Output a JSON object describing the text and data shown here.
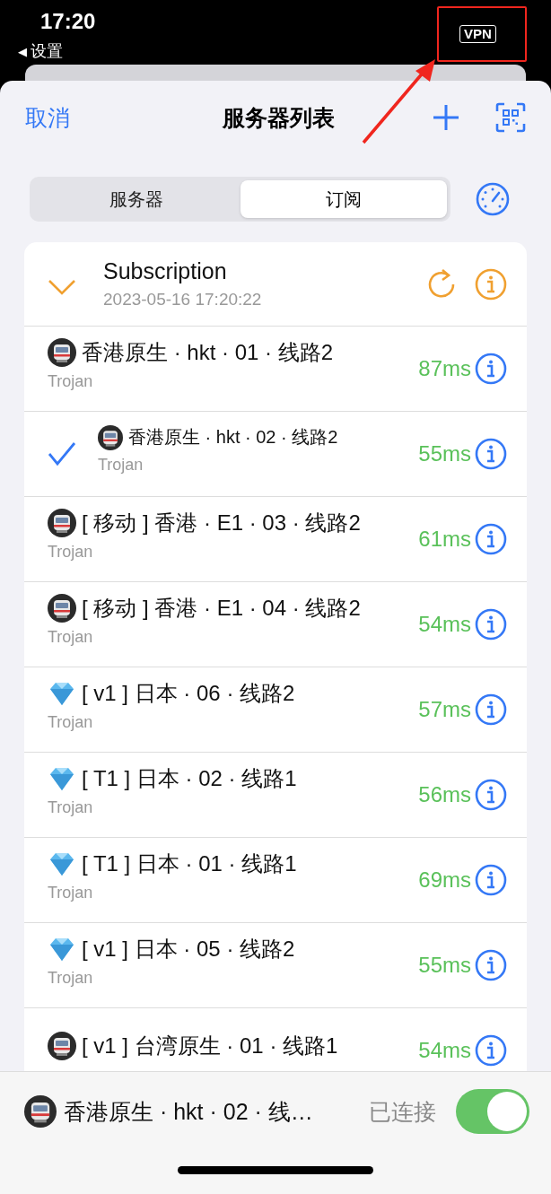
{
  "status_bar": {
    "time": "17:20",
    "back_arrow": "◀",
    "back_label": "设置",
    "vpn": "VPN"
  },
  "nav": {
    "cancel": "取消",
    "title": "服务器列表"
  },
  "tabs": [
    {
      "label": "服务器",
      "selected": false
    },
    {
      "label": "订阅",
      "selected": true
    }
  ],
  "group": {
    "name": "Subscription",
    "updated": "2023-05-16 17:20:22",
    "expanded": true
  },
  "servers": [
    {
      "kind": "train",
      "name": "香港原生 · hkt · 01 · 线路2",
      "protocol": "Trojan",
      "latency": "87ms",
      "selected": false
    },
    {
      "kind": "train",
      "name": "香港原生 · hkt  · 02 · 线路2",
      "protocol": "Trojan",
      "latency": "55ms",
      "selected": true
    },
    {
      "kind": "train",
      "name": "[ 移动 ] 香港 · E1 · 03 · 线路2",
      "protocol": "Trojan",
      "latency": "61ms",
      "selected": false
    },
    {
      "kind": "train",
      "name": "[ 移动 ] 香港 · E1 · 04 · 线路2",
      "protocol": "Trojan",
      "latency": "54ms",
      "selected": false
    },
    {
      "kind": "gem",
      "name": "[ v1 ] 日本 · 06 · 线路2",
      "protocol": "Trojan",
      "latency": "57ms",
      "selected": false
    },
    {
      "kind": "gem",
      "name": "[ T1 ] 日本 · 02 · 线路1",
      "protocol": "Trojan",
      "latency": "56ms",
      "selected": false
    },
    {
      "kind": "gem",
      "name": "[ T1 ] 日本 · 01 · 线路1",
      "protocol": "Trojan",
      "latency": "69ms",
      "selected": false
    },
    {
      "kind": "gem",
      "name": "[ v1 ] 日本 · 05 · 线路2",
      "protocol": "Trojan",
      "latency": "55ms",
      "selected": false
    },
    {
      "kind": "train",
      "name": "[ v1 ] 台湾原生 · 01 · 线路1",
      "latency": "54ms",
      "selected": false
    }
  ],
  "current": {
    "kind": "train",
    "name": "香港原生 · hkt  · 02 · 线…",
    "status": "已连接",
    "on": true
  }
}
